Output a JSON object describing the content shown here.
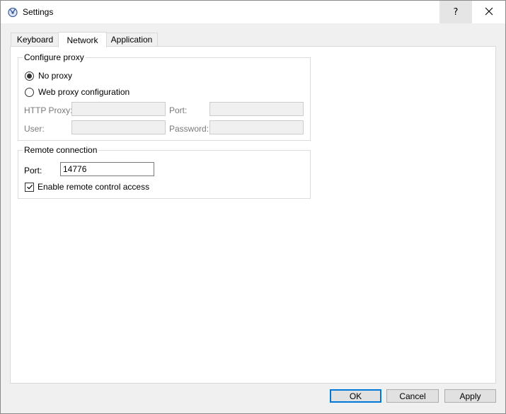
{
  "window": {
    "title": "Settings",
    "help_glyph": "?",
    "close_glyph": "✕"
  },
  "tabs": [
    {
      "label": "Keyboard",
      "active": false
    },
    {
      "label": "Network",
      "active": true
    },
    {
      "label": "Application",
      "active": false
    }
  ],
  "proxy": {
    "legend": "Configure proxy",
    "options": [
      {
        "label": "No proxy",
        "selected": true
      },
      {
        "label": "Web proxy configuration",
        "selected": false
      }
    ],
    "http_proxy_label": "HTTP Proxy:",
    "http_proxy_value": "",
    "port_label": "Port:",
    "port_value": "",
    "user_label": "User:",
    "user_value": "",
    "password_label": "Password:",
    "password_value": ""
  },
  "remote": {
    "legend": "Remote connection",
    "port_label": "Port:",
    "port_value": "14776",
    "enable_label": "Enable remote control access",
    "enable_checked": true
  },
  "buttons": {
    "ok": "OK",
    "cancel": "Cancel",
    "apply": "Apply"
  },
  "colors": {
    "accent": "#0078d7",
    "close_red": "#e81123"
  }
}
